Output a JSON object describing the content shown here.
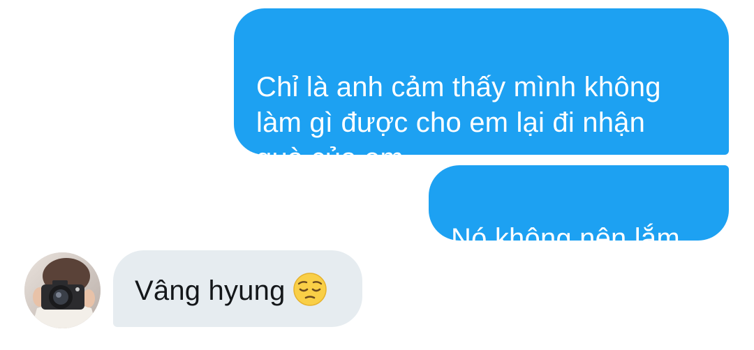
{
  "conversation": {
    "messages": [
      {
        "direction": "outgoing",
        "text": "Chỉ là anh cảm thấy mình không\nlàm gì được cho em lại đi nhận\nquà của em"
      },
      {
        "direction": "outgoing",
        "text": "Nó không nên lắm"
      },
      {
        "direction": "incoming",
        "text": "Vâng hyung",
        "emoji": "pensive-face"
      }
    ]
  },
  "colors": {
    "outgoing_bubble": "#1da1f2",
    "incoming_bubble": "#e6ecf0",
    "outgoing_text": "#ffffff",
    "incoming_text": "#14171a"
  },
  "icons": {
    "avatar": "contact-photo-with-camera",
    "emoji": "pensive-face"
  }
}
